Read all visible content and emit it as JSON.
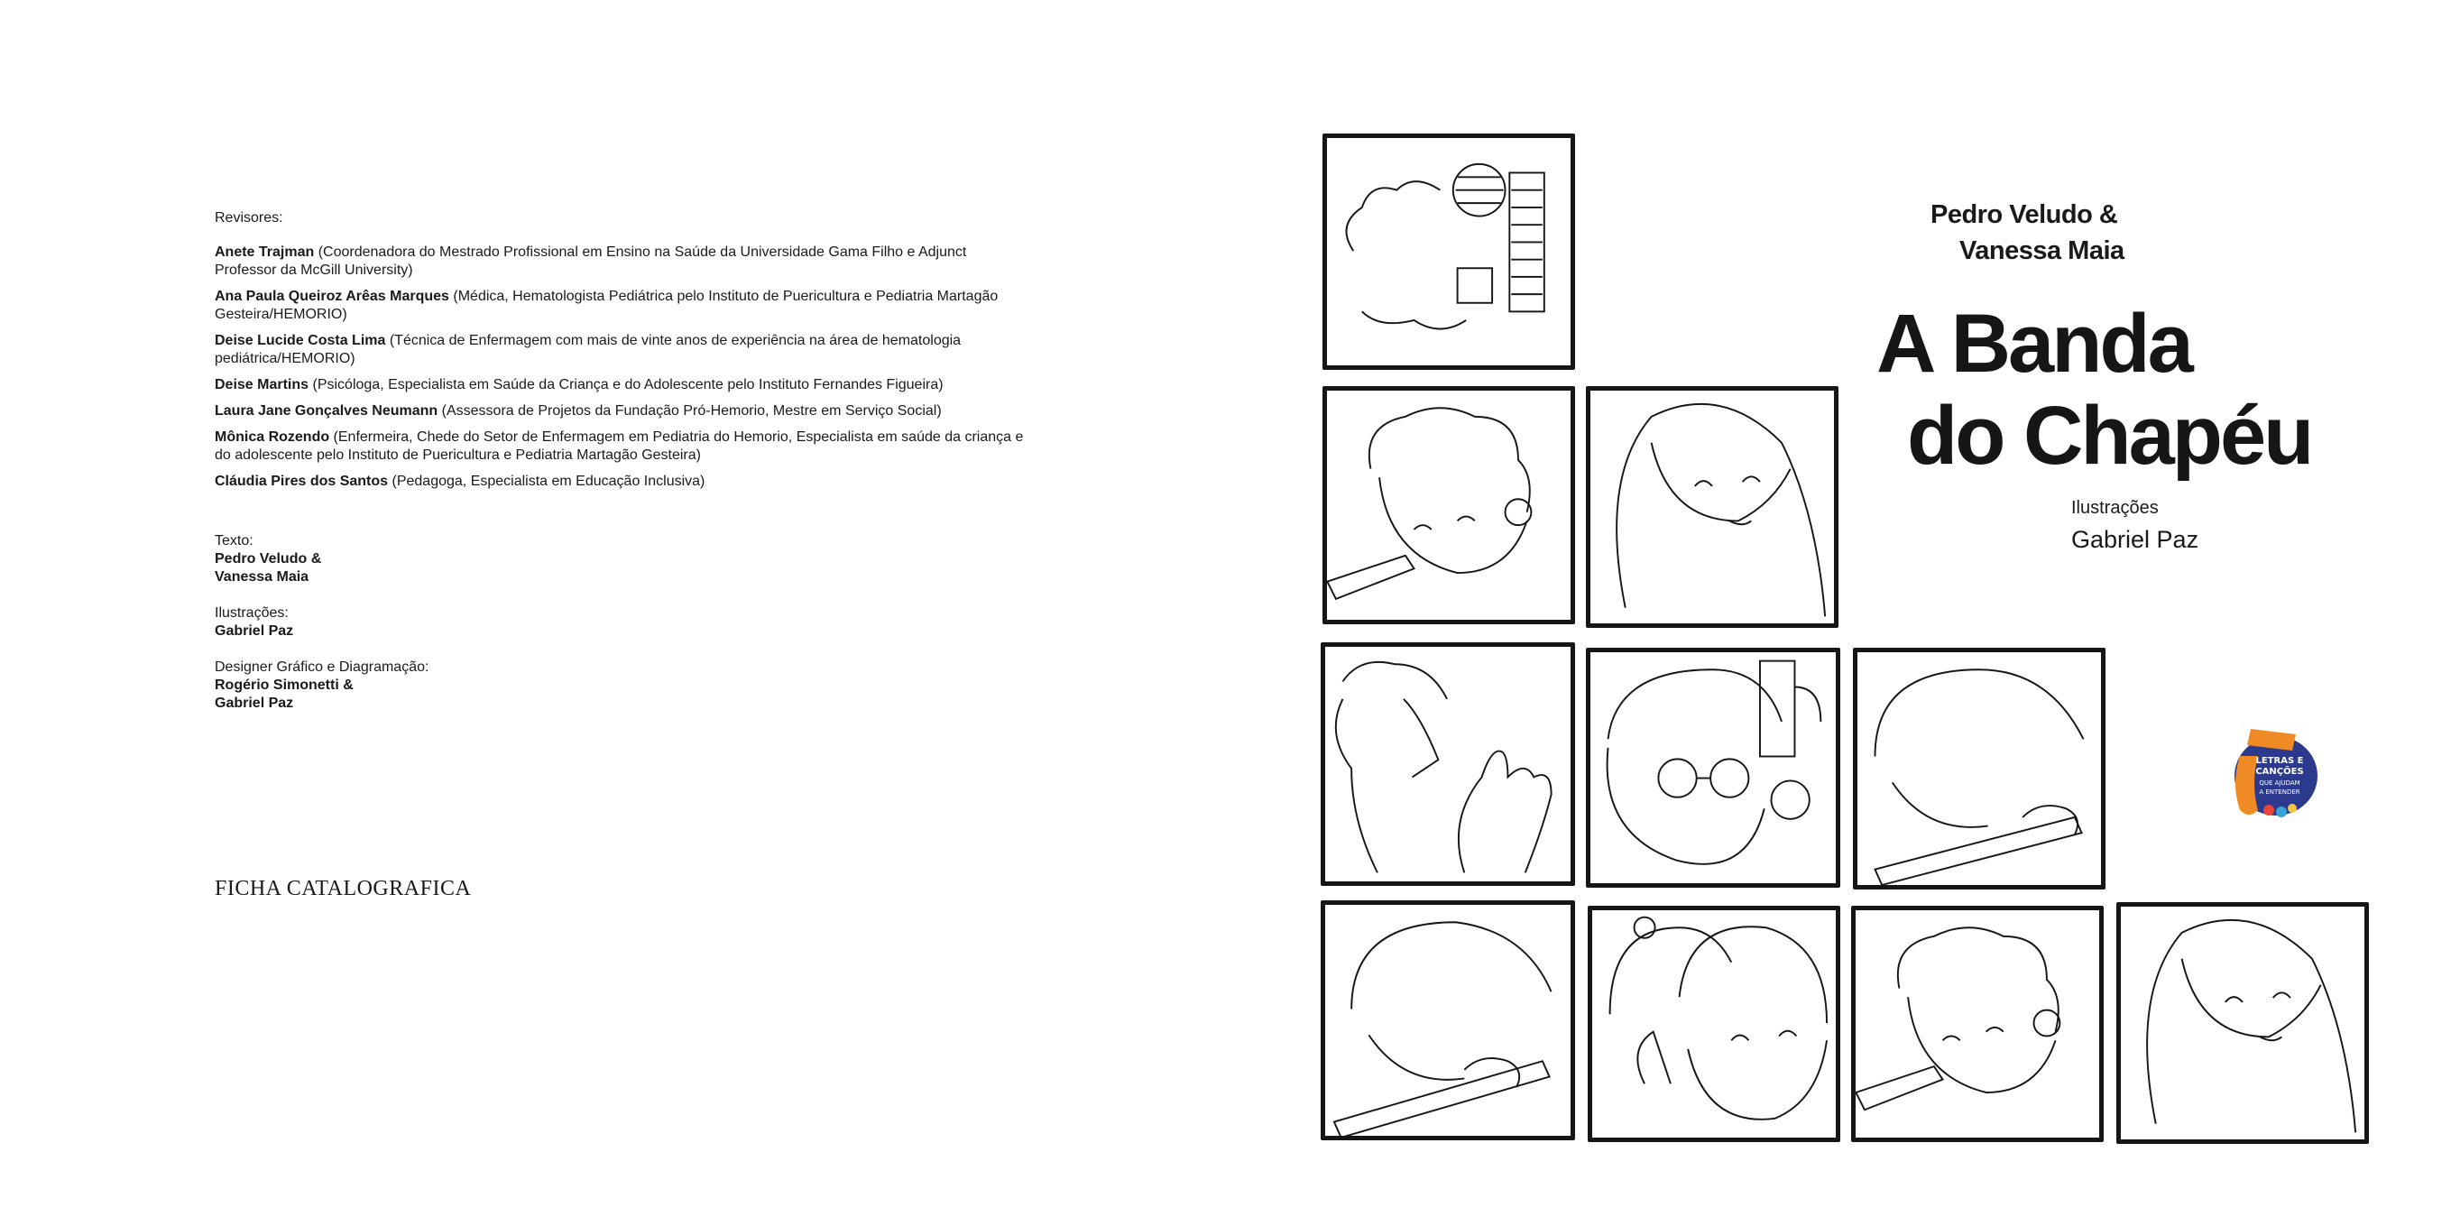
{
  "credits": {
    "reviewers_label": "Revisores:",
    "reviewers": [
      {
        "name": "Anete Trajman",
        "desc": " (Coordenadora do Mestrado Profissional em Ensino na Saúde da Universidade Gama Filho  e Adjunct Professor da McGill University)"
      },
      {
        "name": "Ana Paula Queiroz  Arêas Marques",
        "desc": " (Médica, Hematologista Pediátrica pelo  Instituto de Puericultura e Pediatria Martagão Gesteira/HEMORIO)"
      },
      {
        "name": "Deise Lucide Costa Lima",
        "desc": " (Técnica de Enfermagem com mais de vinte anos de experiência na área de hematologia pediátrica/HEMORIO)"
      },
      {
        "name": "Deise Martins",
        "desc": " (Psicóloga, Especialista em Saúde da Criança e do Adolescente pelo Instituto Fernandes Figueira)"
      },
      {
        "name": "Laura Jane Gonçalves Neumann",
        "desc": " (Assessora de Projetos da Fundação Pró-Hemorio, Mestre em Serviço Social)"
      },
      {
        "name": "Mônica Rozendo",
        "desc": " (Enfermeira, Chede do Setor de Enfermagem em Pediatria do Hemorio, Especialista em saúde da criança e do adolescente pelo Instituto de Puericultura e Pediatria Martagão Gesteira)"
      },
      {
        "name": "Cláudia Pires dos Santos",
        "desc": " (Pedagoga, Especialista em Educação Inclusiva)"
      }
    ],
    "text_label": "Texto:",
    "text_authors": [
      "Pedro Veludo &",
      "Vanessa Maia"
    ],
    "illus_label": "Ilustrações:",
    "illus_name": "Gabriel Paz",
    "design_label": "Designer Gráfico e Diagramação:",
    "design_names": [
      "Rogério Simonetti &",
      "Gabriel Paz"
    ],
    "ficha": "FICHA CATALOGRAFICA"
  },
  "cover": {
    "authors": [
      "Pedro Veludo &",
      "Vanessa Maia"
    ],
    "title": [
      "A Banda",
      "do Chapéu"
    ],
    "illus_label": "Ilustrações",
    "illus_name": "Gabriel Paz",
    "badge_text": [
      "LETRAS E",
      "CANÇÕES",
      "QUE AJUDAM",
      "A ENTENDER"
    ]
  },
  "colors": {
    "ink": "#161616",
    "badge_blue": "#2b3a8c",
    "badge_orange": "#f08a24"
  }
}
